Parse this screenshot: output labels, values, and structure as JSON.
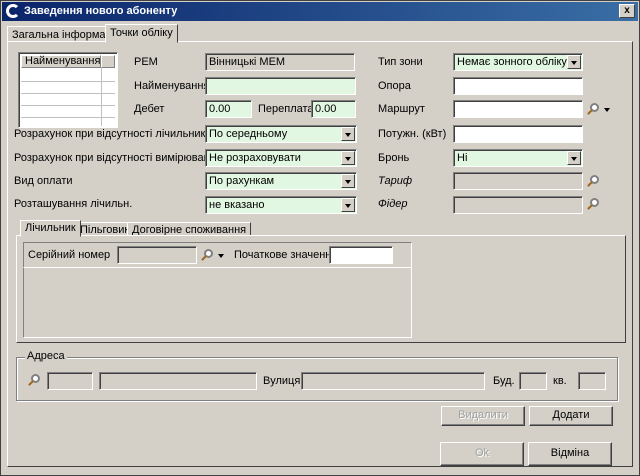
{
  "window": {
    "title": "Заведення нового абоненту",
    "close_glyph": "x"
  },
  "tabs": [
    {
      "label": "Загальна інформація"
    },
    {
      "label": "Точки обліку"
    }
  ],
  "grid": {
    "header": "Найменування"
  },
  "left": {
    "rem_label": "РЕМ",
    "rem_value": "Вінницькі МЕМ",
    "name_label": "Найменування",
    "name_value": "",
    "debet_label": "Дебет",
    "debet_value": "0.00",
    "overpay_label": "Переплата",
    "overpay_value": "0.00",
    "no_meter_label": "Розрахунок при відсутності лічильника",
    "no_meter_value": "По середньому",
    "no_measure_label": "Розрахунок при відсутності вимірювань",
    "no_measure_value": "Не розраховувати",
    "payment_label": "Вид оплати",
    "payment_value": "По рахункам",
    "meter_location_label": "Розташування лічильн.",
    "meter_location_value": "не вказано"
  },
  "right": {
    "zone_label": "Тип зони",
    "zone_value": "Немає зонного обліку",
    "support_label": "Опора",
    "support_value": "",
    "route_label": "Маршрут",
    "route_value": "",
    "power_label": "Потужн. (кВт)",
    "power_value": "",
    "reserve_label": "Бронь",
    "reserve_value": "Ні",
    "tariff_label": "Тариф",
    "tariff_value": "",
    "feeder_label": "Фідер",
    "feeder_value": ""
  },
  "subtabs": [
    {
      "label": "Лічильник"
    },
    {
      "label": "Пільговик"
    },
    {
      "label": "Договірне споживання"
    }
  ],
  "counter": {
    "serial_label": "Серійний номер",
    "serial_value": "",
    "initial_label": "Початкове значення",
    "initial_value": ""
  },
  "address": {
    "legend": "Адреса",
    "street_label": "Вулиця",
    "building_label": "Буд.",
    "apartment_label": "кв."
  },
  "buttons": {
    "delete": "Видалити",
    "add": "Додати",
    "ok": "Ok",
    "cancel": "Відміна"
  },
  "colors": {
    "required_field": "#e2f7e1",
    "titlebar": "#0a246a"
  }
}
